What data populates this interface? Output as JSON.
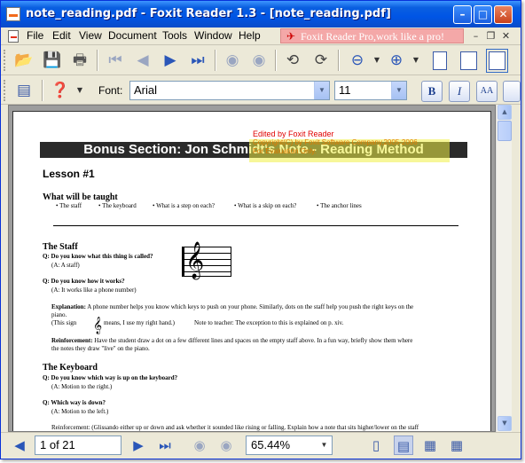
{
  "window": {
    "title": "note_reading.pdf - Foxit Reader 1.3 - [note_reading.pdf]"
  },
  "menu": {
    "items": [
      "File",
      "Edit",
      "View",
      "Document",
      "Tools",
      "Window",
      "Help"
    ],
    "promo": "Foxit Reader Pro,work like a pro!"
  },
  "format_bar": {
    "font_label": "Font:",
    "font_value": "Arial",
    "size_value": "11",
    "bold": "B",
    "italic": "I",
    "font_size_btn": "AA"
  },
  "document": {
    "stamp_line1": "Edited by Foxit Reader",
    "stamp_line2": "Copyright(C) by Foxit Software Company,2005-2006",
    "stamp_line3": "For Evaluation Only.",
    "banner": "Bonus Section:  Jon Schmidt's Note - Reading Method",
    "lesson": "Lesson #1",
    "what_taught_heading": "What will be taught",
    "topics": [
      "• The staff",
      "• The keyboard",
      "• What is a step on each?",
      "• What is a skip on each?",
      "• The anchor lines"
    ],
    "staff_heading": "The Staff",
    "q1": "Q:  Do you know what this thing is called?",
    "a1": "(A: A staff)",
    "q2": "Q:  Do you know how it works?",
    "a2": "(A: It works like a phone number)",
    "expl_label": "Explanation:",
    "expl_line1": " A phone number helps you know which keys to push on your phone.  Similarly, dots on the staff help you push the right keys on the",
    "expl_line2": "piano.",
    "expl_line3a": "(This sign",
    "expl_line3b": "means, I use my right hand.)",
    "expl_note": "Note to teacher: The exception to this is explained on p. xiv.",
    "reinf_label": "Reinforcement:",
    "reinf_line1": " Have the student draw a dot on a few different lines and spaces on the empty staff above.  In a fun way, briefly show them where",
    "reinf_line2": "the notes they draw \"live\" on the piano.",
    "keyboard_heading": "The Keyboard",
    "q3": "Q:  Do you know which way is up on the keyboard?",
    "a3": "(A: Motion to the right.)",
    "q4": "Q:  Which way is down?",
    "a4": "(A: Motion to the left.)",
    "reinf2": "Reinforcement: (Glissando either up or down and ask whether it sounded like rising or falling.  Explain how a note that sits higher/lower on the staff"
  },
  "status": {
    "page": "1 of 21",
    "zoom": "65.44%"
  }
}
